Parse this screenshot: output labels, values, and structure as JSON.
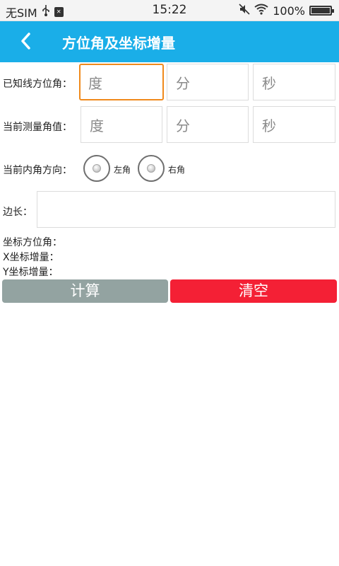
{
  "status_bar": {
    "carrier": "无SIM",
    "time": "15:22",
    "battery": "100%",
    "battery_level": 1.0
  },
  "app_bar": {
    "title": "方位角及坐标增量",
    "back_icon": "chevron-left-icon"
  },
  "form": {
    "azimuth": {
      "label": "已知线方位角：",
      "deg_placeholder": "度",
      "min_placeholder": "分",
      "sec_placeholder": "秒"
    },
    "measured_angle": {
      "label": "当前测量角值：",
      "deg_placeholder": "度",
      "min_placeholder": "分",
      "sec_placeholder": "秒"
    },
    "inner_angle": {
      "label": "当前内角方向：",
      "left_label": "左角",
      "right_label": "右角"
    },
    "side_length": {
      "label": "边长："
    }
  },
  "results": {
    "azimuth_label": "坐标方位角：",
    "dx_label": "X坐标增量：",
    "dy_label": "Y坐标增量："
  },
  "buttons": {
    "calculate": "计算",
    "clear": "清空"
  },
  "colors": {
    "app_bar": "#1aaee8",
    "focus_border": "#f08a1c",
    "calc_button": "#93a3a1",
    "clear_button": "#f42035"
  }
}
